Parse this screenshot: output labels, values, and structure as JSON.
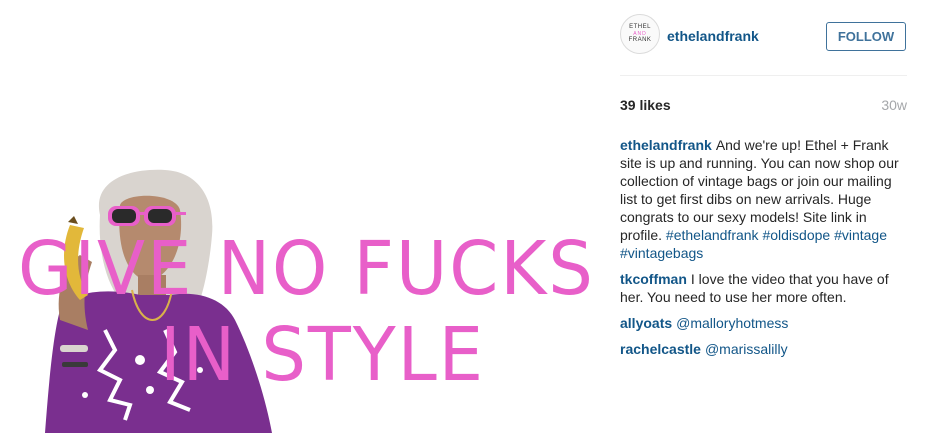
{
  "media": {
    "overlay_line1": "GIVE NO FUCKS",
    "overlay_line2": "IN STYLE",
    "overlay_color": "#e85fc9"
  },
  "header": {
    "avatar_text": [
      "ETHEL",
      "AND",
      "FRANK"
    ],
    "username": "ethelandfrank",
    "follow_label": "FOLLOW"
  },
  "stats": {
    "likes": "39 likes",
    "time": "30w"
  },
  "caption": {
    "user": "ethelandfrank",
    "text": "And we're up! Ethel + Frank site is up and running. You can now shop our collection of vintage bags or join our mailing list to get first dibs on new arrivals. Huge congrats to our sexy models! Site link in profile.",
    "tags": [
      "#ethelandfrank",
      "#oldisdope",
      "#vintage",
      "#vintagebags"
    ]
  },
  "comments": [
    {
      "user": "tkcoffman",
      "text": "I love the video that you have of her. You need to use her more often."
    },
    {
      "user": "allyoats",
      "mention": "@malloryhotmess"
    },
    {
      "user": "rachelcastle",
      "mention": "@marissalilly"
    }
  ],
  "colors": {
    "link": "#125688",
    "button": "#3f729b",
    "muted": "#a5a7aa"
  }
}
